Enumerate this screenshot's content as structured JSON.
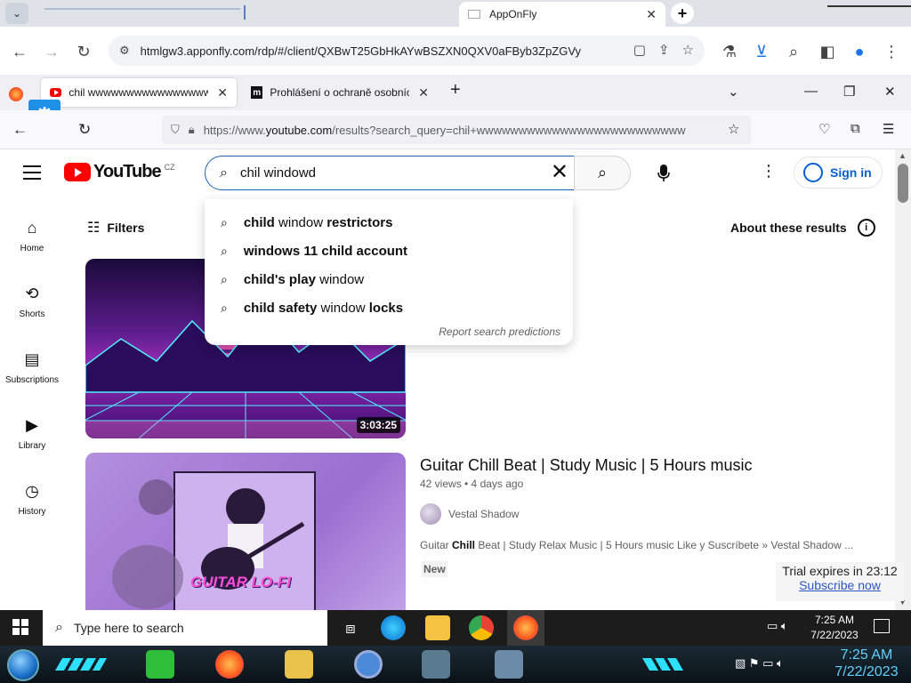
{
  "outer_browser": {
    "active_tab_title": "AppOnFly",
    "url": "htmlgw3.apponfly.com/rdp/#/client/QXBwT25GbHkAYwBSZXN0QXV0aFByb3ZpZGVy"
  },
  "firefox": {
    "tabs": [
      {
        "title": "chil wwwwwwwwwwwwwwww"
      },
      {
        "title": "Prohlášení o ochraně osobních"
      }
    ],
    "url_prefix": "https://www.",
    "url_domain": "youtube.com",
    "url_suffix": "/results?search_query=chil+wwwwwwwwwwwwwwwwwwwwwwwww"
  },
  "youtube": {
    "logo_text": "YouTube",
    "country_code": "CZ",
    "search_value": "chil windowd",
    "sign_in": "Sign in",
    "sidebar": [
      {
        "label": "Home",
        "icon": "home-icon"
      },
      {
        "label": "Shorts",
        "icon": "shorts-icon"
      },
      {
        "label": "Subscriptions",
        "icon": "subscriptions-icon"
      },
      {
        "label": "Library",
        "icon": "library-icon"
      },
      {
        "label": "History",
        "icon": "history-icon"
      }
    ],
    "filters": "Filters",
    "about": "About these results",
    "suggestions": [
      {
        "bold": "child",
        "rest": " window ",
        "bold2": "restrictors"
      },
      {
        "bold": "windows 11 child account",
        "rest": "",
        "bold2": ""
      },
      {
        "bold": "child's play",
        "rest": " window",
        "bold2": ""
      },
      {
        "bold": "child safety",
        "rest": " window ",
        "bold2": "locks"
      }
    ],
    "report_predictions": "Report search predictions",
    "video1": {
      "duration": "3:03:25"
    },
    "video2": {
      "title": "Guitar Chill Beat | Study Music | 5 Hours music",
      "meta": "42 views • 4 days ago",
      "channel": "Vestal Shadow",
      "desc_pre": "Guitar ",
      "desc_bold": "Chill",
      "desc_post": " Beat | Study Relax Music | 5 Hours music Like y Suscríbete » Vestal Shadow ...",
      "badge": "New",
      "thumb_text": "GUITAR LO-FI"
    }
  },
  "trial": {
    "text": "Trial expires in 23:12",
    "link": "Subscribe now"
  },
  "taskbar": {
    "search_placeholder": "Type here to search",
    "time": "7:25 AM",
    "date": "7/22/2023"
  },
  "taskbar2": {
    "time": "7:25 AM",
    "date": "7/22/2023"
  }
}
